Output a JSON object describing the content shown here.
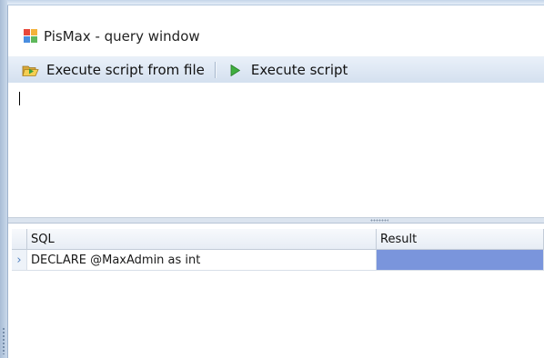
{
  "window": {
    "title": "PisMax - query window",
    "icon": "app-icon"
  },
  "toolbar": {
    "execute_from_file_label": "Execute script from file",
    "execute_from_file_icon": "folder-open-icon",
    "execute_label": "Execute script",
    "execute_icon": "play-icon"
  },
  "editor": {
    "content": ""
  },
  "results": {
    "columns": [
      "SQL",
      "Result"
    ],
    "rows": [
      {
        "indicator": "›",
        "sql": "DECLARE @MaxAdmin as int",
        "result": ""
      }
    ],
    "selected_color": "#7a95dc"
  }
}
